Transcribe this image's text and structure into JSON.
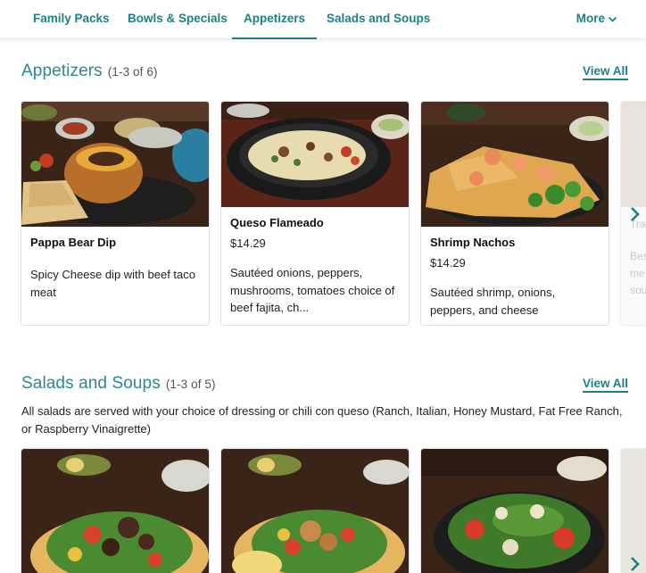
{
  "nav": {
    "tabs": [
      "Family Packs",
      "Bowls & Specials",
      "Appetizers",
      "Salads and Soups"
    ],
    "active": "Appetizers",
    "more_label": "More"
  },
  "appetizers": {
    "title": "Appetizers",
    "count": "(1-3 of 6)",
    "view_all": "View All",
    "items": [
      {
        "name": "Pappa Bear Dip",
        "price": "",
        "desc": "Spicy Cheese dip with beef taco meat",
        "photo": "bread-bowl-cheese-dip-photo"
      },
      {
        "name": "Queso Flameado",
        "price": "$14.29",
        "desc": "Sautéed onions, peppers, mushrooms, tomatoes choice of beef fajita, ch...",
        "photo": "queso-skillet-photo"
      },
      {
        "name": "Shrimp Nachos",
        "price": "$14.29",
        "desc": "Sautéed shrimp, onions, peppers, and cheese",
        "photo": "shrimp-nachos-photo"
      }
    ],
    "peek_text": [
      "Tra",
      "Bes",
      "me",
      "sou"
    ]
  },
  "salads": {
    "title": "Salads and Soups",
    "count": "(1-3 of 5)",
    "view_all": "View All",
    "description": "All salads are served with your choice of dressing or chili con queso (Ranch, Italian, Honey Mustard, Fat Free Ranch, or Raspberry Vinaigrette)",
    "photos": [
      "fajita-taco-salad-photo",
      "chicken-taco-salad-photo",
      "green-salad-photo"
    ]
  },
  "icons": {
    "next": "chevron-right-icon",
    "more": "chevron-down-icon"
  },
  "colors": {
    "accent": "#1f7f86",
    "heading": "#2a8a90"
  }
}
